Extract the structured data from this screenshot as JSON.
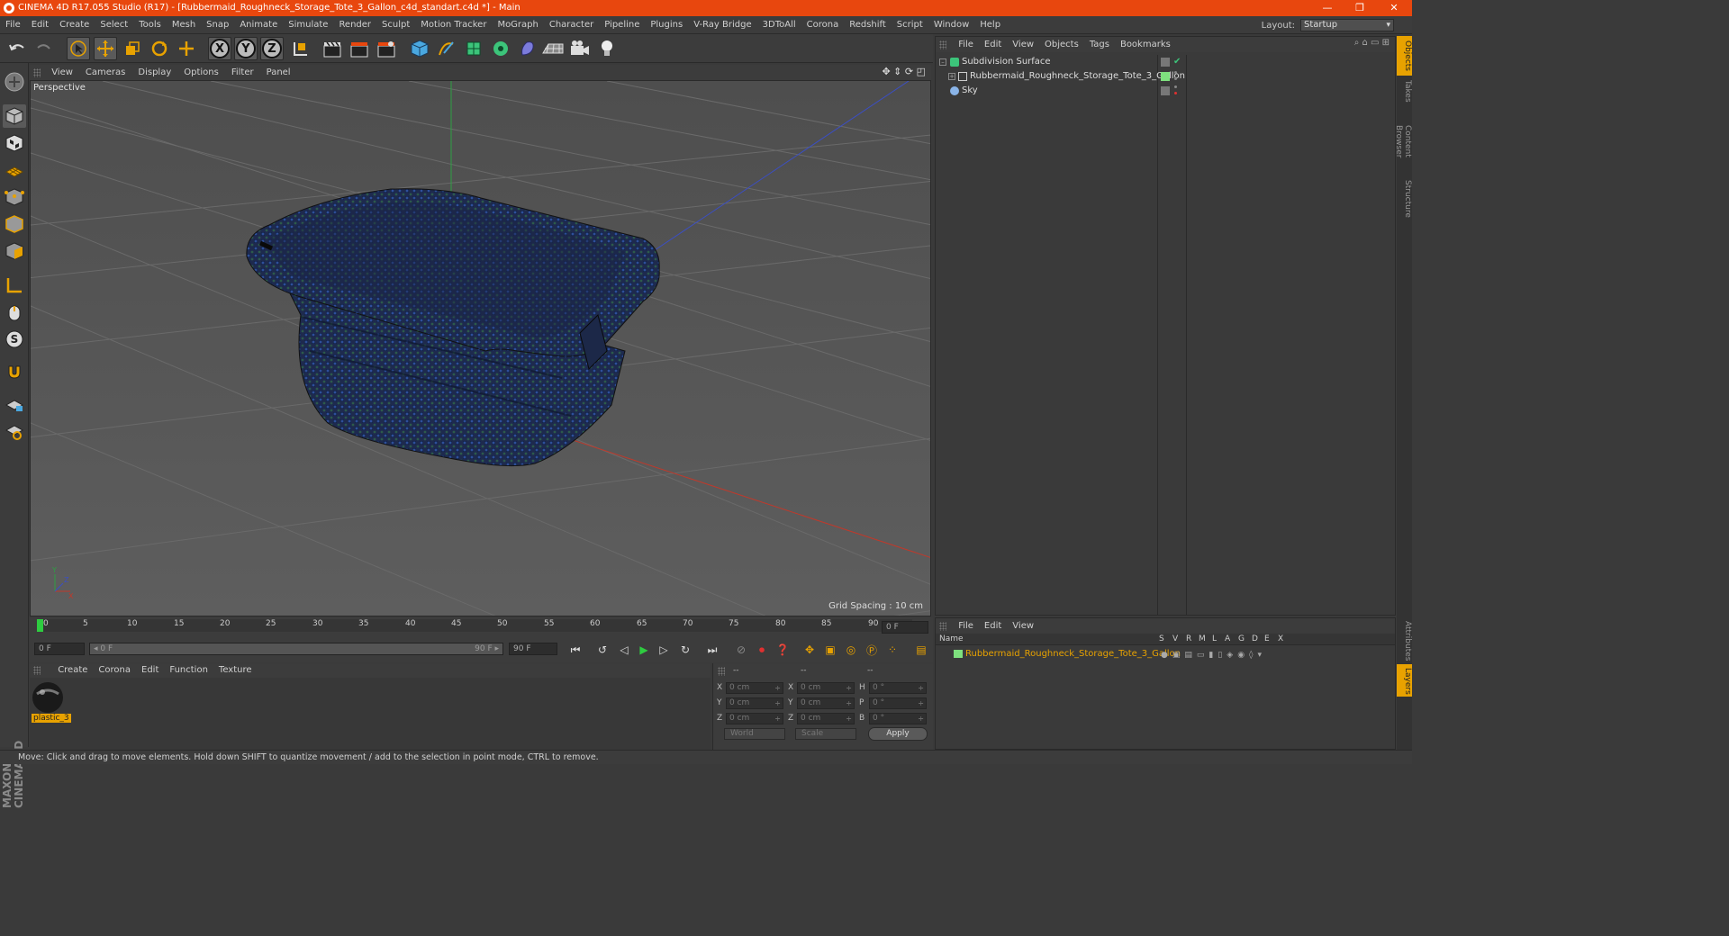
{
  "window": {
    "title": "CINEMA 4D R17.055 Studio (R17) - [Rubbermaid_Roughneck_Storage_Tote_3_Gallon_c4d_standart.c4d *] - Main"
  },
  "menubar": {
    "items": [
      "File",
      "Edit",
      "Create",
      "Select",
      "Tools",
      "Mesh",
      "Snap",
      "Animate",
      "Simulate",
      "Render",
      "Sculpt",
      "Motion Tracker",
      "MoGraph",
      "Character",
      "Pipeline",
      "Plugins",
      "V-Ray Bridge",
      "3DToAll",
      "Corona",
      "Redshift",
      "Script",
      "Window",
      "Help"
    ],
    "layout_label": "Layout:",
    "layout_value": "Startup"
  },
  "toolbar": {
    "axis_x": "X",
    "axis_y": "Y",
    "axis_z": "Z"
  },
  "viewport": {
    "menu": [
      "View",
      "Cameras",
      "Display",
      "Options",
      "Filter",
      "Panel"
    ],
    "label": "Perspective",
    "grid_spacing": "Grid Spacing : 10 cm"
  },
  "timeline": {
    "ticks": [
      "0",
      "5",
      "10",
      "15",
      "20",
      "25",
      "30",
      "35",
      "40",
      "45",
      "50",
      "55",
      "60",
      "65",
      "70",
      "75",
      "80",
      "85",
      "90"
    ],
    "current_frame": "0 F",
    "start_field": "0 F",
    "range_start": "◂ 0 F",
    "range_end": "90 F ▸",
    "end_field": "90 F"
  },
  "material_manager": {
    "menu": [
      "Create",
      "Corona",
      "Edit",
      "Function",
      "Texture"
    ],
    "material_name": "plastic_3"
  },
  "coordinates": {
    "header": [
      "--",
      "--",
      "--"
    ],
    "rows": [
      {
        "a": "X",
        "av": "0 cm",
        "b": "X",
        "bv": "0 cm",
        "c": "H",
        "cv": "0 °"
      },
      {
        "a": "Y",
        "av": "0 cm",
        "b": "Y",
        "bv": "0 cm",
        "c": "P",
        "cv": "0 °"
      },
      {
        "a": "Z",
        "av": "0 cm",
        "b": "Z",
        "bv": "0 cm",
        "c": "B",
        "cv": "0 °"
      }
    ],
    "mode1": "World",
    "mode2": "Scale",
    "apply": "Apply"
  },
  "object_manager": {
    "menu": [
      "File",
      "Edit",
      "View",
      "Objects",
      "Tags",
      "Bookmarks"
    ],
    "objects": [
      {
        "name": "Subdivision Surface"
      },
      {
        "name": "Rubbermaid_Roughneck_Storage_Tote_3_Gallon"
      },
      {
        "name": "Sky"
      }
    ]
  },
  "layer_manager": {
    "menu": [
      "File",
      "Edit",
      "View"
    ],
    "col_name": "Name",
    "cols": [
      "S",
      "V",
      "R",
      "M",
      "L",
      "A",
      "G",
      "D",
      "E",
      "X"
    ],
    "layer_name": "Rubbermaid_Roughneck_Storage_Tote_3_Gallon",
    "layer_color": "#7ee07e"
  },
  "right_tabs": [
    "Objects",
    "Takes",
    "Content Browser",
    "Structure",
    "Attributes",
    "Layers"
  ],
  "status": "Move: Click and drag to move elements. Hold down SHIFT to quantize movement / add to the selection in point mode, CTRL to remove.",
  "branding": "MAXON CINEMA 4D",
  "colors": {
    "titlebar": "#e8470e",
    "accent": "#e8a200",
    "x_axis": "#c0392b",
    "y_axis": "#2ea043",
    "z_axis": "#3b4fc4"
  }
}
